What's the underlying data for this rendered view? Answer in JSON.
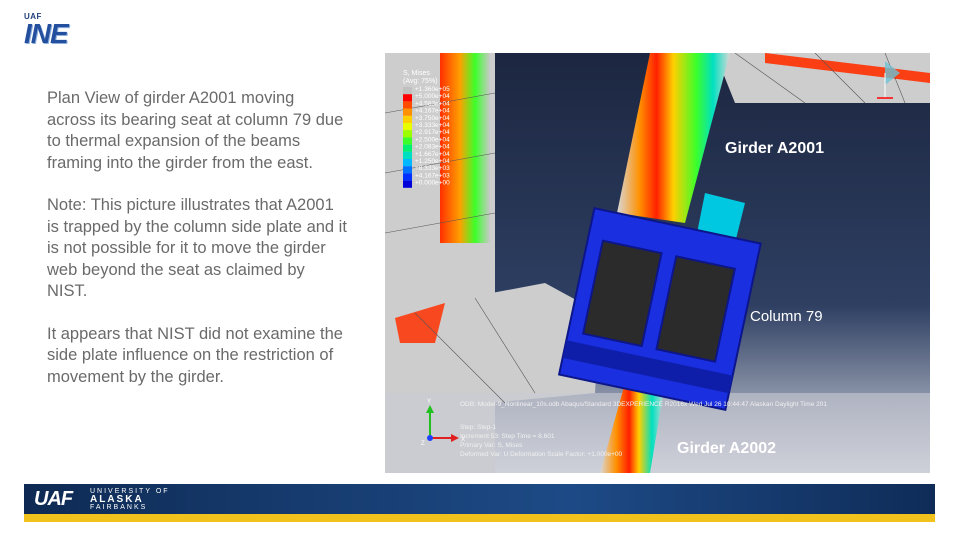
{
  "logo": {
    "top_label": "UAF",
    "main_label": "INE"
  },
  "body_text": {
    "paragraph1": "Plan View of girder A2001 moving across its bearing seat at column 79 due to thermal expansion of the beams framing into the girder from the east.",
    "paragraph2": "Note:  This picture  illustrates that A2001 is trapped by the column side plate and it is not possible for it to move the girder web beyond the seat as claimed by NIST.",
    "paragraph3": "It appears that NIST did not examine the side plate influence on the restriction of movement by the girder."
  },
  "figure": {
    "legend_title": "S, Mises",
    "legend_subtitle": "(Avg: 75%)",
    "legend_values": [
      "+1.360e+05",
      "+5.000e+04",
      "+4.583e+04",
      "+4.167e+04",
      "+3.750e+04",
      "+3.333e+04",
      "+2.917e+04",
      "+2.500e+04",
      "+2.083e+04",
      "+1.667e+04",
      "+1.250e+04",
      "+8.333e+03",
      "+4.167e+03",
      "+0.000e+00"
    ],
    "legend_colors": [
      "#c0c0c0",
      "#ff0000",
      "#ff4a00",
      "#ff9000",
      "#ffd000",
      "#e8ff00",
      "#9cff00",
      "#3cff2a",
      "#00f070",
      "#00e0c0",
      "#00b8ff",
      "#0070ff",
      "#0030ff",
      "#0000d8"
    ],
    "label_girder_a2001": "Girder A2001",
    "label_column_79": "Column 79",
    "label_girder_a2002": "Girder A2002",
    "info_line": "ODB: Model-9_Nonlinear_10s.odb    Abaqus/Standard 3DEXPERIENCE R2016x    Wed Jul 26 10:44:47 Alaskan Daylight Time 201",
    "step_line": "Step: Step-1",
    "increment_line": "Increment    53: Step Time =    8.601",
    "primary_var_line": "Primary Var: S, Mises",
    "deformed_var_line": "Deformed Var: U   Deformation Scale Factor: +1.000e+00",
    "axis_y": "Y",
    "axis_x": "X",
    "axis_z": "Z"
  },
  "footer": {
    "mark": "UAF",
    "university_of": "UNIVERSITY OF",
    "alaska": "ALASKA",
    "fairbanks": "FAIRBANKS"
  },
  "colors": {
    "title_blue": "#234f9e",
    "text_gray": "#6a6a6a",
    "gold": "#f1c21b",
    "navy": "#0e2a54"
  }
}
